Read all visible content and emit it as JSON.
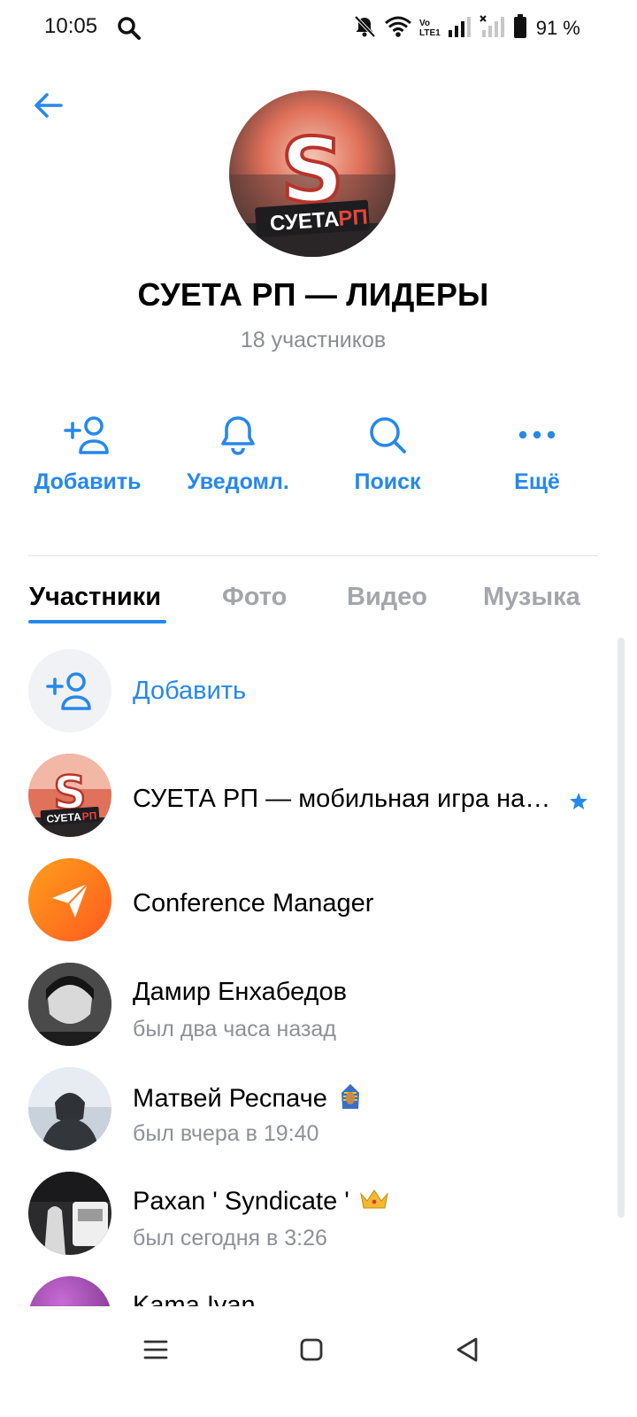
{
  "status_bar": {
    "time": "10:05",
    "battery_text": "91 %",
    "icons": [
      "search-icon",
      "bell-off-icon",
      "wifi-icon",
      "volte-icon",
      "signal-icon",
      "signal-no-service-icon",
      "battery-icon"
    ],
    "volte_line1": "Vo",
    "volte_line2": "LTE1"
  },
  "header": {
    "back_icon": "back-arrow-icon",
    "title": "СУЕТА РП — ЛИДЕРЫ",
    "subtitle": "18 участников",
    "avatar_text_main": "СУЕТА",
    "avatar_text_accent": "РП",
    "avatar_letter": "S"
  },
  "actions": [
    {
      "label": "Добавить",
      "icon": "add-user-icon"
    },
    {
      "label": "Уведомл.",
      "icon": "bell-icon"
    },
    {
      "label": "Поиск",
      "icon": "search-icon"
    },
    {
      "label": "Ещё",
      "icon": "more-icon"
    }
  ],
  "tabs": [
    {
      "label": "Участники",
      "active": true
    },
    {
      "label": "Фото",
      "active": false
    },
    {
      "label": "Видео",
      "active": false
    },
    {
      "label": "Музыка",
      "active": false
    }
  ],
  "members": {
    "add_label": "Добавить",
    "items": [
      {
        "name": "СУЕТА РП — мобильная игра на…",
        "status": "",
        "badge": "star-icon",
        "avatar_text_main": "СУЕТА",
        "avatar_text_accent": "РП",
        "avatar_letter": "S"
      },
      {
        "name": "Conference Manager",
        "status": ""
      },
      {
        "name": "Дамир Енхабедов",
        "status": "был два часа назад"
      },
      {
        "name": "Матвей Респаче",
        "status": "был вчера в 19:40",
        "emoji": "pharaoh-emoji"
      },
      {
        "name": "Paxan ' Syndicate '",
        "status": "был сегодня в 3:26",
        "emoji": "crown-emoji"
      },
      {
        "name": "Kama Ivan",
        "status": ""
      }
    ]
  },
  "colors": {
    "accent": "#2688eb",
    "secondary_text": "#8e9196",
    "tab_inactive": "#a3a6aa",
    "conference_gradient_start": "#ff9800",
    "conference_gradient_end": "#ff5722"
  },
  "nav_bar": {
    "buttons": [
      "menu-icon",
      "home-icon",
      "back-triangle-icon"
    ]
  }
}
